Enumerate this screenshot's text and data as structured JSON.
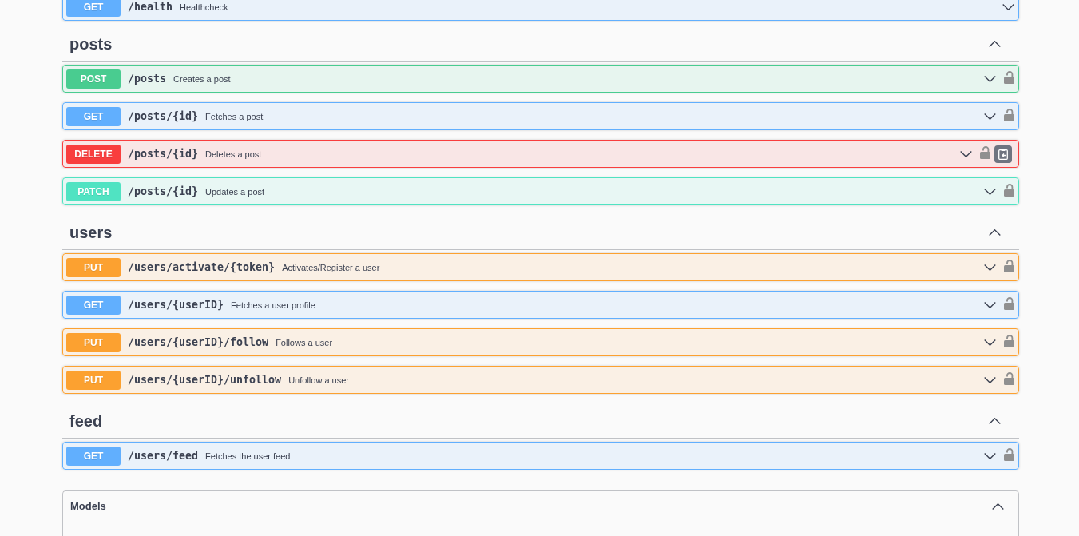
{
  "sections": [
    {
      "endpoints": [
        {
          "method": "GET",
          "color": "#61affe",
          "path": "/health",
          "summary": "Healthcheck",
          "expanded": false,
          "secured": false,
          "copy_button": false
        }
      ]
    },
    {
      "title": "posts",
      "expanded": true,
      "endpoints": [
        {
          "method": "POST",
          "color": "#49cc90",
          "path": "/posts",
          "summary": "Creates a post",
          "expanded": false,
          "secured": true,
          "copy_button": false
        },
        {
          "method": "GET",
          "color": "#61affe",
          "path": "/posts/{id}",
          "summary": "Fetches a post",
          "expanded": false,
          "secured": true,
          "copy_button": false
        },
        {
          "method": "DELETE",
          "color": "#f93e3e",
          "path": "/posts/{id}",
          "summary": "Deletes a post",
          "expanded": false,
          "secured": true,
          "copy_button": true
        },
        {
          "method": "PATCH",
          "color": "#50e3c2",
          "path": "/posts/{id}",
          "summary": "Updates a post",
          "expanded": false,
          "secured": true,
          "copy_button": false
        }
      ]
    },
    {
      "title": "users",
      "expanded": true,
      "endpoints": [
        {
          "method": "PUT",
          "color": "#fca130",
          "path": "/users/activate/{token}",
          "summary": "Activates/Register a user",
          "expanded": false,
          "secured": true,
          "copy_button": false
        },
        {
          "method": "GET",
          "color": "#61affe",
          "path": "/users/{userID}",
          "summary": "Fetches a user profile",
          "expanded": false,
          "secured": true,
          "copy_button": false
        },
        {
          "method": "PUT",
          "color": "#fca130",
          "path": "/users/{userID}/follow",
          "summary": "Follows a user",
          "expanded": false,
          "secured": true,
          "copy_button": false
        },
        {
          "method": "PUT",
          "color": "#fca130",
          "path": "/users/{userID}/unfollow",
          "summary": "Unfollow a user",
          "expanded": false,
          "secured": true,
          "copy_button": false
        }
      ]
    },
    {
      "title": "feed",
      "expanded": true,
      "endpoints": [
        {
          "method": "GET",
          "color": "#61affe",
          "path": "/users/feed",
          "summary": "Fetches the user feed",
          "expanded": false,
          "secured": true,
          "copy_button": false
        }
      ]
    }
  ],
  "models": {
    "title": "Models",
    "expanded": true
  }
}
